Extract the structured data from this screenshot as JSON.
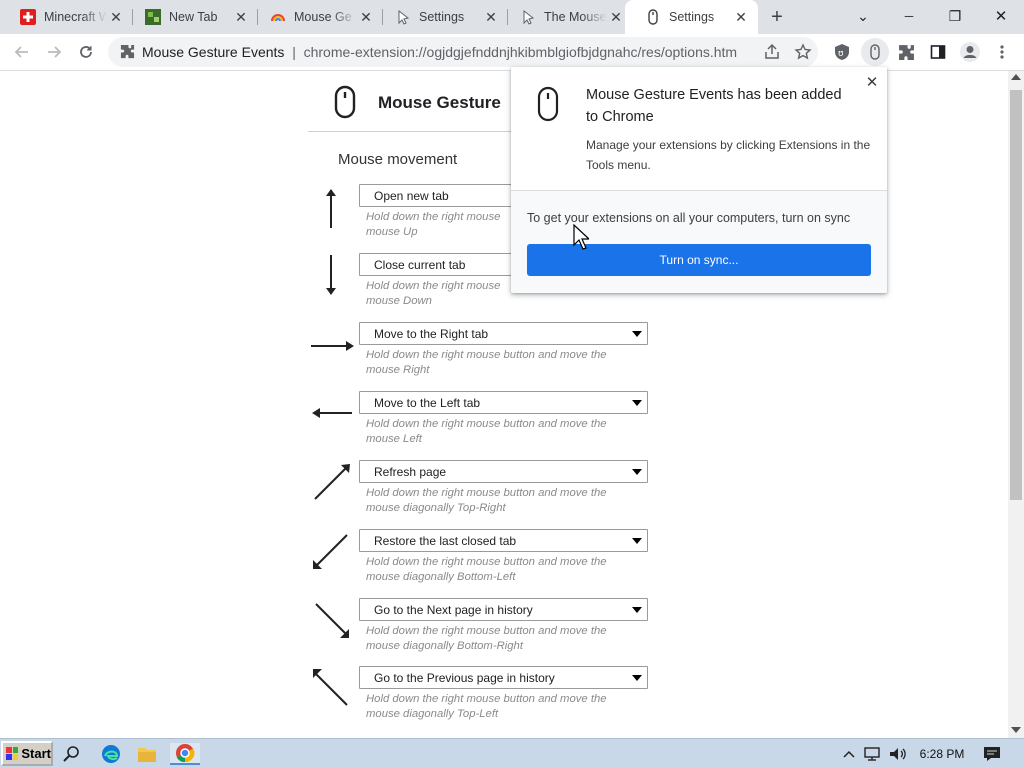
{
  "tabs": [
    {
      "title": "Minecraft W",
      "close": "✕",
      "icon": "minecraft-icon"
    },
    {
      "title": "New Tab",
      "close": "✕",
      "icon": "newtab-icon"
    },
    {
      "title": "Mouse Ge",
      "close": "✕",
      "icon": "rainbow-icon"
    },
    {
      "title": "Settings",
      "close": "✕",
      "icon": "cursor-icon"
    },
    {
      "title": "The Mouse",
      "close": "✕",
      "icon": "cursor-icon"
    },
    {
      "title": "Settings",
      "close": "✕",
      "icon": "mouse-icon"
    }
  ],
  "new_tab": "+",
  "window_controls": {
    "tab_search": "⌄",
    "minimize": "─",
    "restore": "❐",
    "close": "✕"
  },
  "address": {
    "site_name": "Mouse Gesture Events",
    "separator": "|",
    "url": "chrome-extension://ogjdgjefnddnjhkibmblgiofbjdgnahc/res/options.htm"
  },
  "page": {
    "title": "Mouse Gesture",
    "section_heading": "Mouse movement",
    "gestures": [
      {
        "direction": "up",
        "action": "Open new tab",
        "desc_line1": "Hold down the right mouse",
        "desc_line2": "mouse Up"
      },
      {
        "direction": "down",
        "action": "Close current tab",
        "desc_line1": "Hold down the right mouse",
        "desc_line2": "mouse Down"
      },
      {
        "direction": "right",
        "action": "Move to the Right tab",
        "desc_line1": "Hold down the right mouse button and move the",
        "desc_line2": "mouse Right"
      },
      {
        "direction": "left",
        "action": "Move to the Left tab",
        "desc_line1": "Hold down the right mouse button and move the",
        "desc_line2": "mouse Left"
      },
      {
        "direction": "top-right",
        "action": "Refresh page",
        "desc_line1": "Hold down the right mouse button and move the",
        "desc_line2": "mouse diagonally Top-Right"
      },
      {
        "direction": "bottom-left",
        "action": "Restore the last closed tab",
        "desc_line1": "Hold down the right mouse button and move the",
        "desc_line2": "mouse diagonally Bottom-Left"
      },
      {
        "direction": "bottom-right",
        "action": "Go to the Next page in history",
        "desc_line1": "Hold down the right mouse button and move the",
        "desc_line2": "mouse diagonally Bottom-Right"
      },
      {
        "direction": "top-left",
        "action": "Go to the Previous page in history",
        "desc_line1": "Hold down the right mouse button and move the",
        "desc_line2": "mouse diagonally Top-Left"
      }
    ]
  },
  "popup": {
    "heading": "Mouse Gesture Events has been added to Chrome",
    "subtext": "Manage your extensions by clicking Extensions in the Tools menu.",
    "sync_text": "To get your extensions on all your computers, turn on sync",
    "sync_button": "Turn on sync...",
    "close": "✕"
  },
  "taskbar": {
    "start_label": "Start",
    "clock": "6:28 PM"
  },
  "colors": {
    "accent": "#1a73e8",
    "tabstrip": "#dee1e6",
    "taskbar": "#c8d8e8"
  }
}
